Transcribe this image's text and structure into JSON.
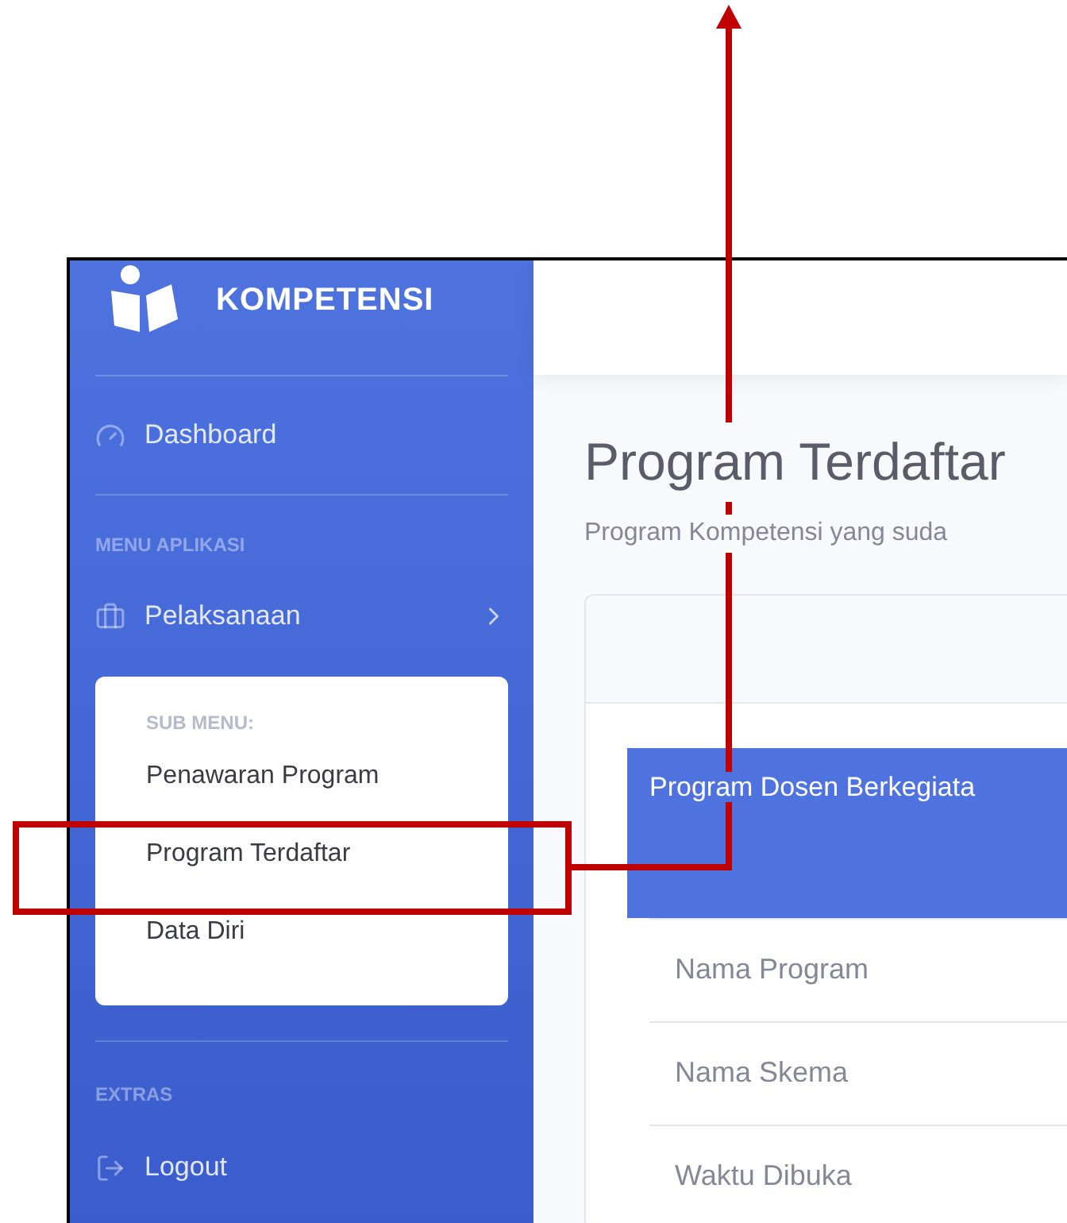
{
  "brand": {
    "title": "KOMPETENSI"
  },
  "sidebar": {
    "dashboard": "Dashboard",
    "menu_heading": "MENU APLIKASI",
    "pelaksanaan": "Pelaksanaan",
    "submenu": {
      "heading": "SUB MENU:",
      "items": [
        "Penawaran Program",
        "Program Terdaftar",
        "Data Diri"
      ]
    },
    "extras_heading": "EXTRAS",
    "logout": "Logout"
  },
  "page": {
    "title": "Program Terdaftar",
    "subtitle": "Program Kompetensi yang suda"
  },
  "card": {
    "table_header": "Program Dosen Berkegiata",
    "rows": [
      "Nama Program",
      "Nama Skema",
      "Waktu Dibuka"
    ]
  }
}
